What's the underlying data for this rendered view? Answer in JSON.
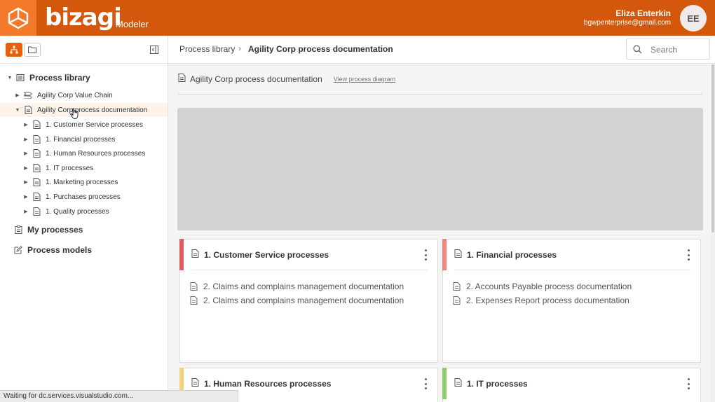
{
  "header": {
    "brand": "bizagi",
    "product": "Modeler",
    "user_name": "Eliza Enterkin",
    "user_email": "bgwpenterprise@gmail.com",
    "avatar_initials": "EE",
    "brand_color": "#d4580b"
  },
  "sidebar": {
    "root": {
      "label": "Process library",
      "icon": "library-icon",
      "expanded": true
    },
    "items": [
      {
        "label": "Agility Corp Value Chain",
        "icon": "value-chain-icon",
        "expanded": false
      },
      {
        "label": "Agility Corp process documentation",
        "icon": "document-icon",
        "expanded": true,
        "selected": true
      }
    ],
    "children": [
      {
        "label": "1. Customer Service processes"
      },
      {
        "label": "1. Financial processes"
      },
      {
        "label": "1. Human Resources processes"
      },
      {
        "label": "1. IT processes"
      },
      {
        "label": "1. Marketing processes"
      },
      {
        "label": "1. Purchases processes"
      },
      {
        "label": "1. Quality processes"
      }
    ],
    "sections": [
      {
        "label": "My processes",
        "icon": "clipboard-icon"
      },
      {
        "label": "Process models",
        "icon": "edit-icon"
      }
    ]
  },
  "breadcrumb": {
    "root": "Process library",
    "current": "Agility Corp process documentation"
  },
  "search": {
    "placeholder": "Search"
  },
  "document": {
    "title": "Agility Corp process documentation",
    "link": "View process diagram"
  },
  "cards": [
    {
      "title": "1. Customer Service processes",
      "accent": "#e05b63",
      "children": [
        "2. Claims and complains management documentation",
        "2. Claims and complains management documentation"
      ]
    },
    {
      "title": "1. Financial processes",
      "accent": "#f0857a",
      "children": [
        "2. Accounts Payable process documentation",
        "2. Expenses Report process documentation"
      ]
    },
    {
      "title": "1. Human Resources processes",
      "accent": "#f3d27a",
      "children": []
    },
    {
      "title": "1. IT processes",
      "accent": "#8dcb6b",
      "children": []
    }
  ],
  "status": {
    "text": "Waiting for dc.services.visualstudio.com..."
  }
}
